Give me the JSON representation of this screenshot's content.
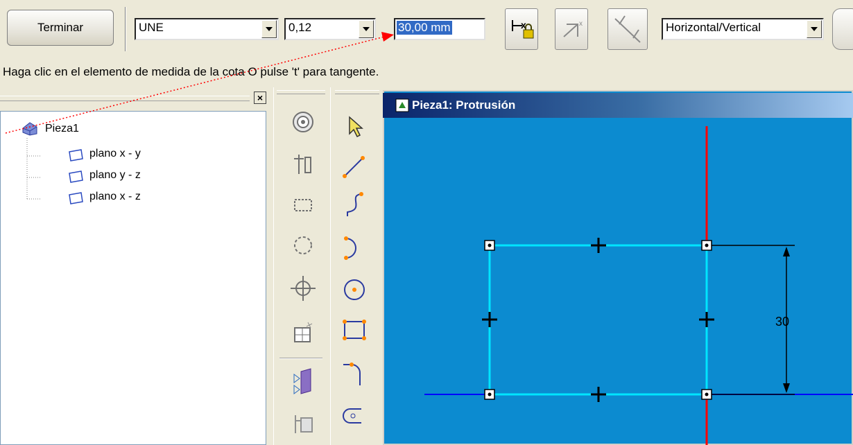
{
  "toolbar": {
    "finish_label": "Terminar",
    "standard_value": "UNE",
    "tolerance_value": "0,12",
    "dimension_value": "30,00 mm",
    "orientation_value": "Horizontal/Vertical"
  },
  "prompt": "Haga clic en el elemento de medida de la cota O pulse 't' para tangente.",
  "tree": {
    "root": "Pieza1",
    "items": [
      "plano x - y",
      "plano y - z",
      "plano x - z"
    ]
  },
  "window": {
    "title": "Pieza1: Protrusión"
  },
  "sketch": {
    "dimension_label": "30"
  },
  "colors": {
    "canvas": "#0c8bd0",
    "sketch_line": "#00e5ff",
    "axis_vertical": "#ff0000",
    "axis_horizontal": "#0000ff",
    "annotation_arrow": "#ff0000"
  }
}
